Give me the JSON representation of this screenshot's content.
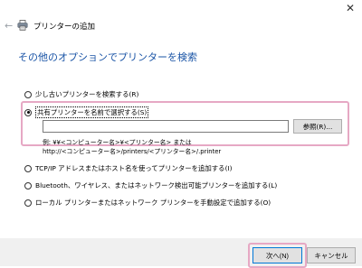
{
  "window": {
    "close_glyph": "✕",
    "back_glyph": "←",
    "icon": "printer-icon",
    "title": "プリンターの追加"
  },
  "heading": "その他のオプションでプリンターを検索",
  "options": {
    "older": {
      "label": "少し古いプリンターを検索する(R)",
      "selected": false
    },
    "shared": {
      "label": "共有プリンターを名前で選択する(S)",
      "selected": true
    },
    "tcpip": {
      "label": "TCP/IP アドレスまたはホスト名を使ってプリンターを追加する(I)",
      "selected": false
    },
    "bluetooth": {
      "label": "Bluetooth、ワイヤレス、またはネットワーク検出可能プリンターを追加する(L)",
      "selected": false
    },
    "local": {
      "label": "ローカル プリンターまたはネットワーク プリンターを手動設定で追加する(O)",
      "selected": false
    }
  },
  "shared_printer": {
    "value": "",
    "browse_label": "参照(R)...",
    "example_line1": "例: ¥¥<コンピューター名>¥<プリンター名> または",
    "example_line2": "http://<コンピューター名>/printers/<プリンター名>/.printer"
  },
  "footer": {
    "next_label": "次へ(N)",
    "cancel_label": "キャンセル"
  },
  "colors": {
    "heading": "#1a54a6",
    "highlight": "#e6a8c4",
    "footer_bg": "#f0f0f0"
  }
}
